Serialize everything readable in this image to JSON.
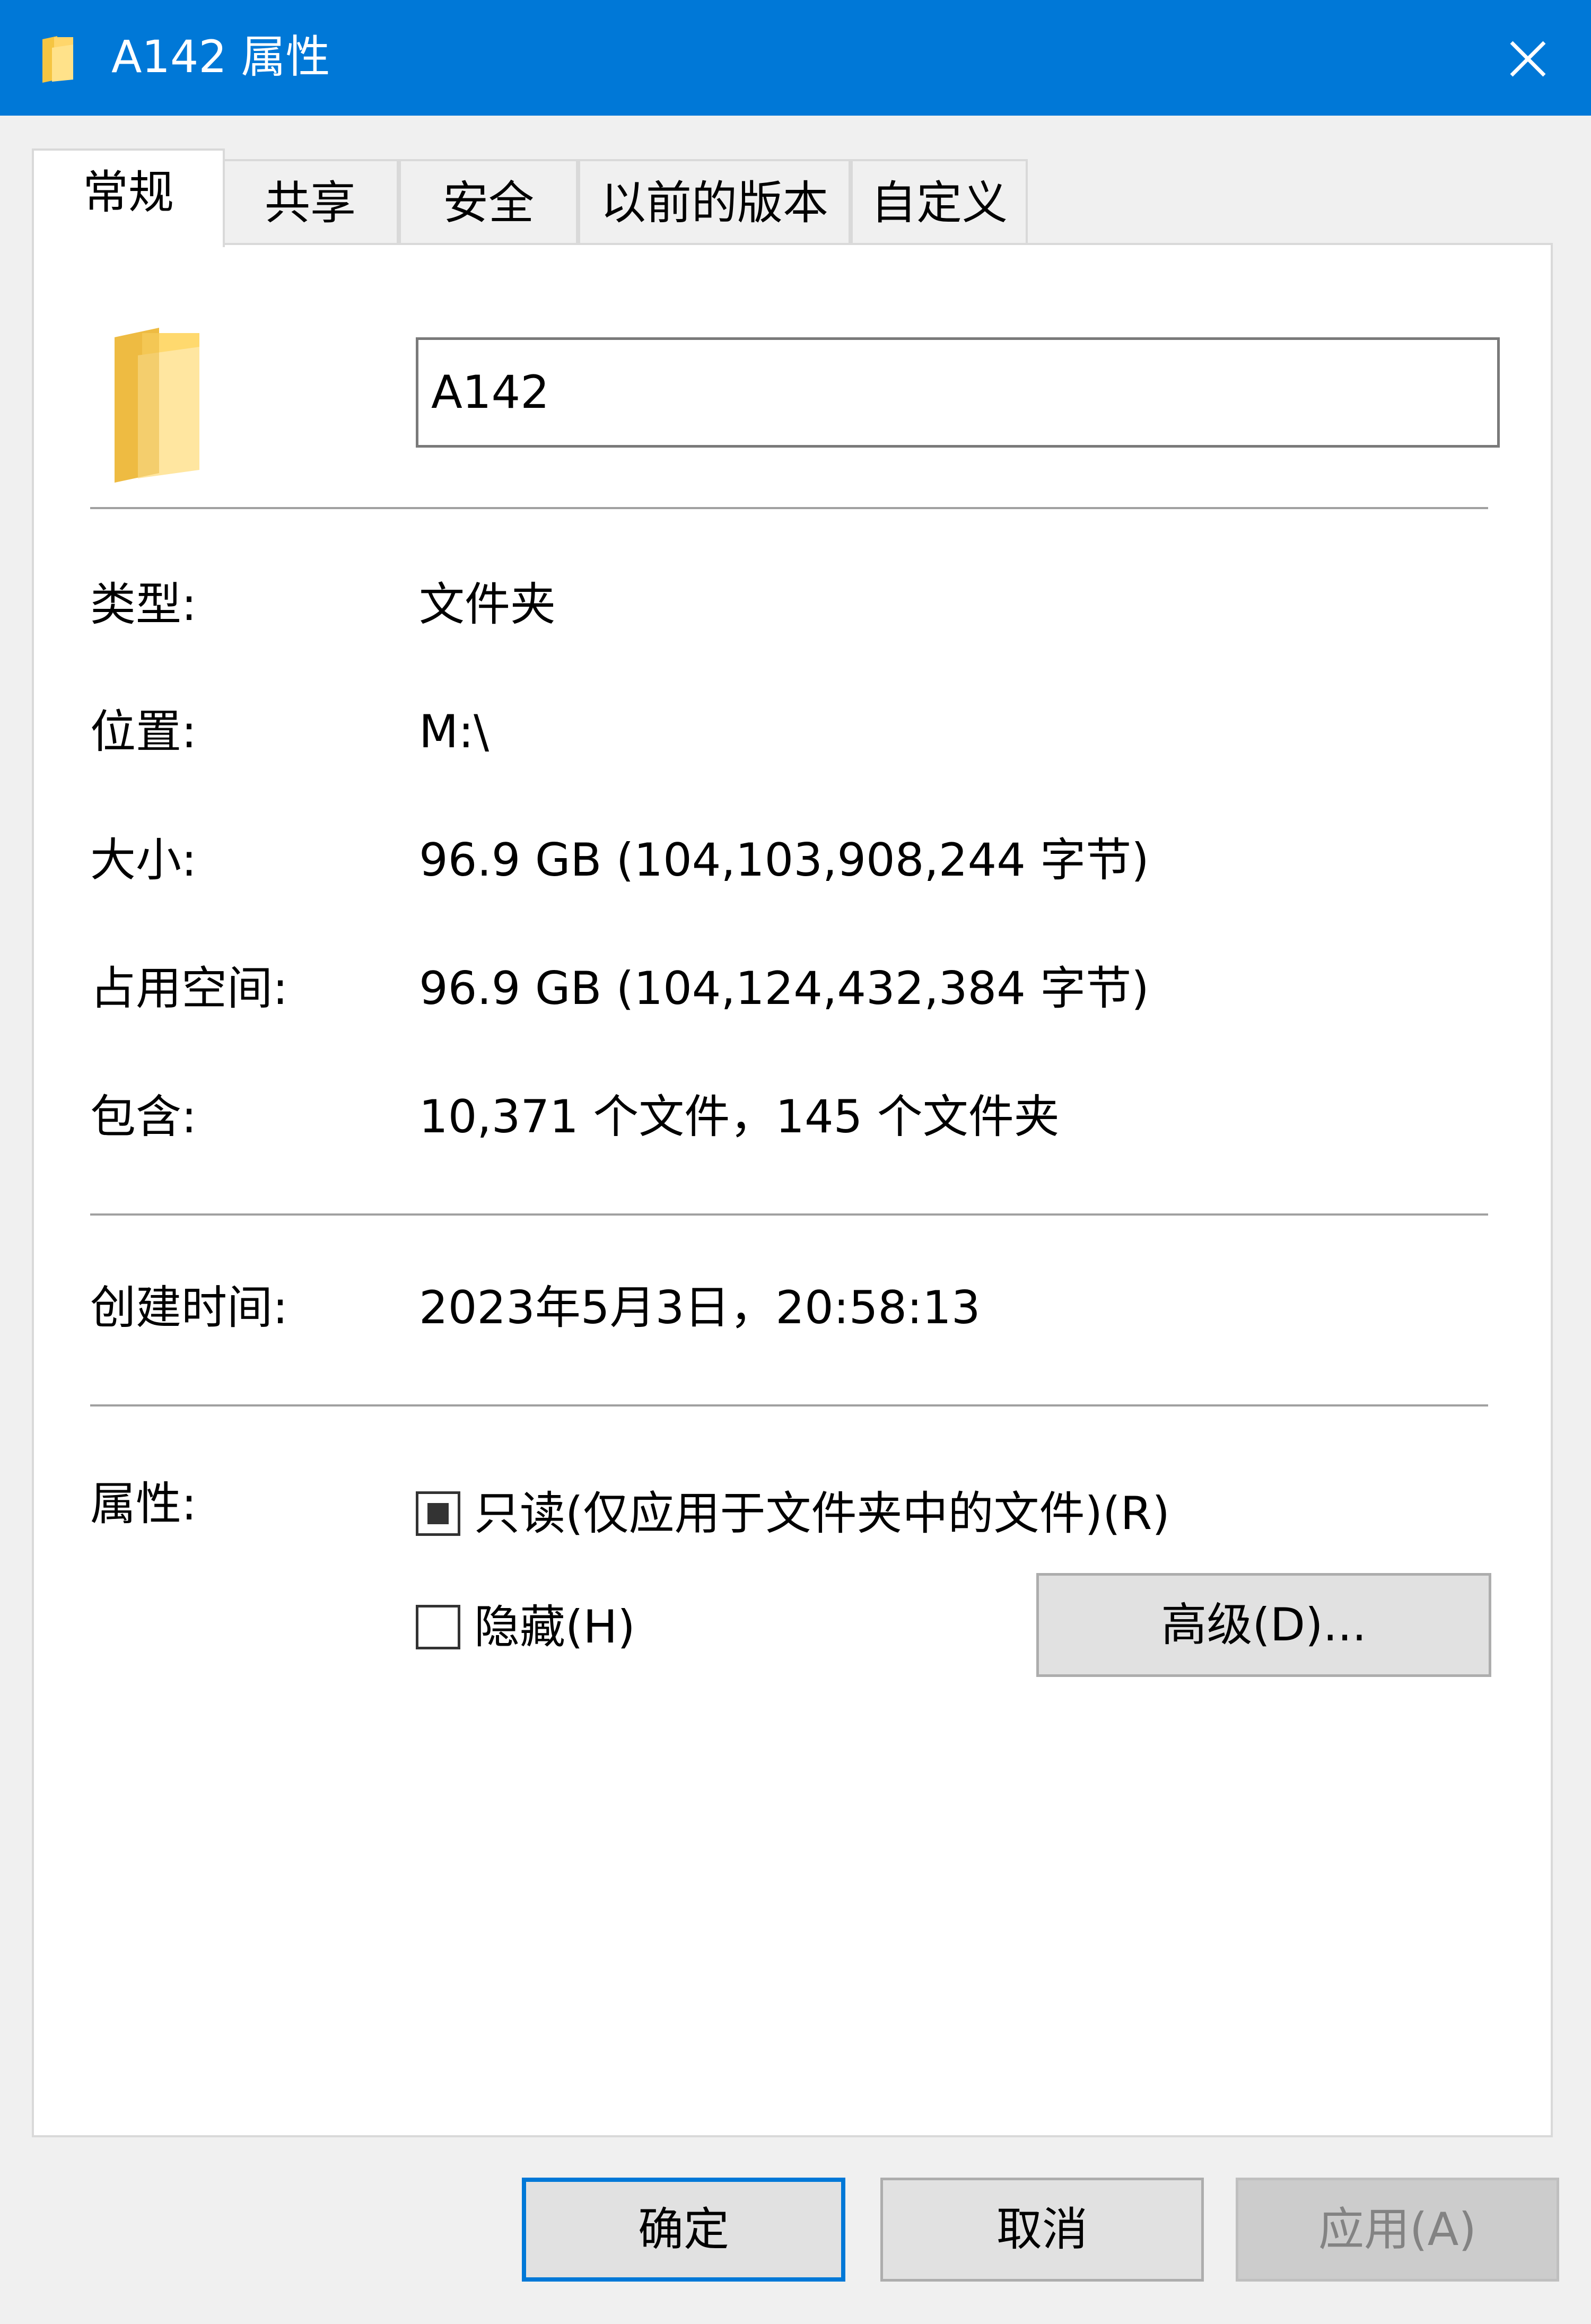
{
  "window": {
    "title": "A142 属性",
    "accent_color": "#0078d7",
    "close_icon": "close-icon"
  },
  "tabs": [
    {
      "label": "常规",
      "active": true
    },
    {
      "label": "共享",
      "active": false
    },
    {
      "label": "安全",
      "active": false
    },
    {
      "label": "以前的版本",
      "active": false
    },
    {
      "label": "自定义",
      "active": false
    }
  ],
  "general": {
    "folder_icon": "folder-icon",
    "name_value": "A142",
    "details": [
      {
        "label": "类型:",
        "value": "文件夹"
      },
      {
        "label": "位置:",
        "value": "M:\\"
      },
      {
        "label": "大小:",
        "value": "96.9 GB (104,103,908,244 字节)"
      },
      {
        "label": "占用空间:",
        "value": "96.9 GB (104,124,432,384 字节)"
      },
      {
        "label": "包含:",
        "value": "10,371 个文件，145 个文件夹"
      }
    ],
    "created": {
      "label": "创建时间:",
      "value": "2023年5月3日，20:58:13"
    },
    "attributes": {
      "label": "属性:",
      "readonly": {
        "label": "只读(仅应用于文件夹中的文件)(R)",
        "state": "indeterminate"
      },
      "hidden": {
        "label": "隐藏(H)",
        "state": "unchecked"
      },
      "advanced_label": "高级(D)..."
    }
  },
  "footer": {
    "ok_label": "确定",
    "cancel_label": "取消",
    "apply_label": "应用(A)",
    "apply_enabled": false
  }
}
